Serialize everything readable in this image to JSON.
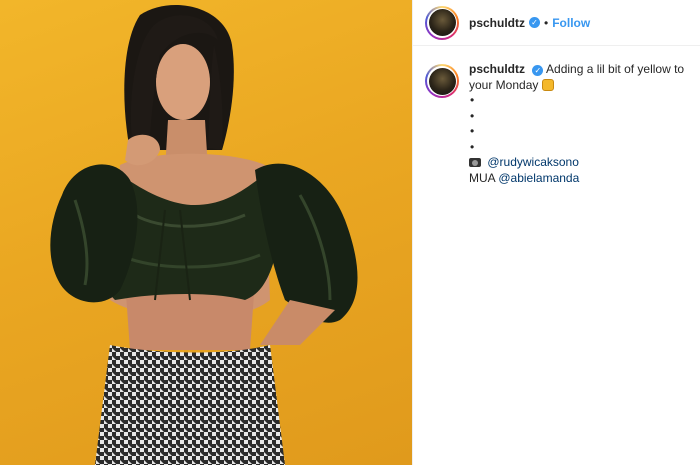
{
  "post": {
    "username": "pschuldtz",
    "follow_label": "Follow",
    "separator": "•",
    "caption": {
      "text": "Adding a lil bit of yellow to your Monday",
      "bullets": [
        "•",
        "•",
        "•",
        "•"
      ],
      "photo_credit": "@rudywicaksono",
      "mua_label": "MUA",
      "mua_handle": "@abielamanda"
    }
  },
  "colors": {
    "background_yellow": "#eaa722",
    "follow_blue": "#3897f0",
    "verified_blue": "#3897f0"
  },
  "icons": [
    "verified-icon",
    "camera-icon",
    "hand-emoji-icon"
  ]
}
